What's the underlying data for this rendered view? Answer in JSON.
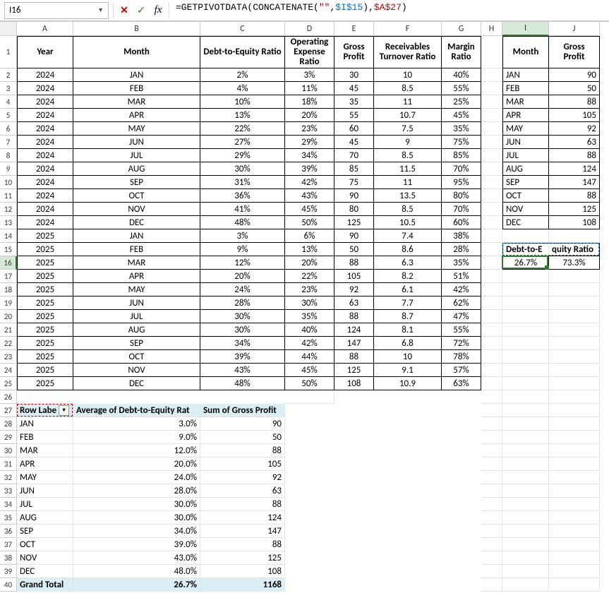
{
  "namebox": {
    "value": "I16"
  },
  "formula": {
    "prefix": "=GETPIVOTDATA(CONCATENATE(",
    "quote": "\"\"",
    "sep1": ",",
    "ref1": "$I$15",
    "close1": ")",
    "sep2": ",",
    "ref2": "$A$27",
    "close2": ")"
  },
  "columns": {
    "A": "A",
    "B": "B",
    "C": "C",
    "D": "D",
    "E": "E",
    "F": "F",
    "G": "G",
    "H": "H",
    "I": "I",
    "J": "J"
  },
  "headers": {
    "year": "Year",
    "month": "Month",
    "dte": "Debt-to-Equity Ratio",
    "oer": "Operating Expense Ratio",
    "gp": "Gross Profit",
    "rtr": "Receivables Turnover Ratio",
    "mr": "Margin Ratio",
    "month2": "Month",
    "gp2": "Gross Profit"
  },
  "main": [
    {
      "y": "2024",
      "m": "JAN",
      "dte": "2%",
      "oer": "3%",
      "gp": "30",
      "rtr": "10",
      "mr": "40%"
    },
    {
      "y": "2024",
      "m": "FEB",
      "dte": "4%",
      "oer": "11%",
      "gp": "45",
      "rtr": "8.5",
      "mr": "55%"
    },
    {
      "y": "2024",
      "m": "MAR",
      "dte": "10%",
      "oer": "18%",
      "gp": "35",
      "rtr": "11",
      "mr": "25%"
    },
    {
      "y": "2024",
      "m": "APR",
      "dte": "13%",
      "oer": "20%",
      "gp": "55",
      "rtr": "10.7",
      "mr": "45%"
    },
    {
      "y": "2024",
      "m": "MAY",
      "dte": "22%",
      "oer": "23%",
      "gp": "60",
      "rtr": "7.5",
      "mr": "35%"
    },
    {
      "y": "2024",
      "m": "JUN",
      "dte": "27%",
      "oer": "29%",
      "gp": "45",
      "rtr": "9",
      "mr": "75%"
    },
    {
      "y": "2024",
      "m": "JUL",
      "dte": "29%",
      "oer": "34%",
      "gp": "70",
      "rtr": "8.5",
      "mr": "85%"
    },
    {
      "y": "2024",
      "m": "AUG",
      "dte": "30%",
      "oer": "39%",
      "gp": "85",
      "rtr": "11.5",
      "mr": "70%"
    },
    {
      "y": "2024",
      "m": "SEP",
      "dte": "31%",
      "oer": "42%",
      "gp": "75",
      "rtr": "11",
      "mr": "95%"
    },
    {
      "y": "2024",
      "m": "OCT",
      "dte": "36%",
      "oer": "43%",
      "gp": "90",
      "rtr": "13.5",
      "mr": "80%"
    },
    {
      "y": "2024",
      "m": "NOV",
      "dte": "41%",
      "oer": "45%",
      "gp": "80",
      "rtr": "8.5",
      "mr": "70%"
    },
    {
      "y": "2024",
      "m": "DEC",
      "dte": "48%",
      "oer": "50%",
      "gp": "125",
      "rtr": "10.5",
      "mr": "60%"
    },
    {
      "y": "2025",
      "m": "JAN",
      "dte": "3%",
      "oer": "6%",
      "gp": "90",
      "rtr": "7.4",
      "mr": "38%"
    },
    {
      "y": "2025",
      "m": "FEB",
      "dte": "9%",
      "oer": "13%",
      "gp": "50",
      "rtr": "8.6",
      "mr": "28%"
    },
    {
      "y": "2025",
      "m": "MAR",
      "dte": "12%",
      "oer": "20%",
      "gp": "88",
      "rtr": "6.3",
      "mr": "35%"
    },
    {
      "y": "2025",
      "m": "APR",
      "dte": "20%",
      "oer": "22%",
      "gp": "105",
      "rtr": "8.2",
      "mr": "51%"
    },
    {
      "y": "2025",
      "m": "MAY",
      "dte": "24%",
      "oer": "23%",
      "gp": "92",
      "rtr": "6.1",
      "mr": "42%"
    },
    {
      "y": "2025",
      "m": "JUN",
      "dte": "28%",
      "oer": "30%",
      "gp": "63",
      "rtr": "7.7",
      "mr": "62%"
    },
    {
      "y": "2025",
      "m": "JUL",
      "dte": "30%",
      "oer": "35%",
      "gp": "88",
      "rtr": "8.7",
      "mr": "47%"
    },
    {
      "y": "2025",
      "m": "AUG",
      "dte": "30%",
      "oer": "40%",
      "gp": "124",
      "rtr": "8.1",
      "mr": "55%"
    },
    {
      "y": "2025",
      "m": "SEP",
      "dte": "34%",
      "oer": "42%",
      "gp": "147",
      "rtr": "6.8",
      "mr": "72%"
    },
    {
      "y": "2025",
      "m": "OCT",
      "dte": "39%",
      "oer": "44%",
      "gp": "88",
      "rtr": "10",
      "mr": "78%"
    },
    {
      "y": "2025",
      "m": "NOV",
      "dte": "43%",
      "oer": "45%",
      "gp": "125",
      "rtr": "9.1",
      "mr": "57%"
    },
    {
      "y": "2025",
      "m": "DEC",
      "dte": "48%",
      "oer": "50%",
      "gp": "108",
      "rtr": "10.9",
      "mr": "63%"
    }
  ],
  "side": [
    {
      "m": "JAN",
      "gp": "90"
    },
    {
      "m": "FEB",
      "gp": "50"
    },
    {
      "m": "MAR",
      "gp": "88"
    },
    {
      "m": "APR",
      "gp": "105"
    },
    {
      "m": "MAY",
      "gp": "92"
    },
    {
      "m": "JUN",
      "gp": "63"
    },
    {
      "m": "JUL",
      "gp": "88"
    },
    {
      "m": "AUG",
      "gp": "124"
    },
    {
      "m": "SEP",
      "gp": "147"
    },
    {
      "m": "OCT",
      "gp": "88"
    },
    {
      "m": "NOV",
      "gp": "125"
    },
    {
      "m": "DEC",
      "gp": "108"
    }
  ],
  "sidehdr": {
    "i": "Debt-to-Equity Ratio",
    "j": "Debt-to-Equity Ratio"
  },
  "sidevals": {
    "i": "26.7%",
    "j": "73.3%"
  },
  "pivot": {
    "rowlbl": "Row Labe",
    "avglbl": "Average of Debt-to-Equity Rat",
    "sumlbl": "Sum of Gross Profit",
    "rows": [
      {
        "m": "JAN",
        "a": "3.0%",
        "s": "90"
      },
      {
        "m": "FEB",
        "a": "9.0%",
        "s": "50"
      },
      {
        "m": "MAR",
        "a": "12.0%",
        "s": "88"
      },
      {
        "m": "APR",
        "a": "20.0%",
        "s": "105"
      },
      {
        "m": "MAY",
        "a": "24.0%",
        "s": "92"
      },
      {
        "m": "JUN",
        "a": "28.0%",
        "s": "63"
      },
      {
        "m": "JUL",
        "a": "30.0%",
        "s": "88"
      },
      {
        "m": "AUG",
        "a": "30.0%",
        "s": "124"
      },
      {
        "m": "SEP",
        "a": "34.0%",
        "s": "147"
      },
      {
        "m": "OCT",
        "a": "39.0%",
        "s": "88"
      },
      {
        "m": "NOV",
        "a": "43.0%",
        "s": "125"
      },
      {
        "m": "DEC",
        "a": "48.0%",
        "s": "108"
      }
    ],
    "grand": {
      "lbl": "Grand Total",
      "a": "26.7%",
      "s": "1168"
    }
  }
}
